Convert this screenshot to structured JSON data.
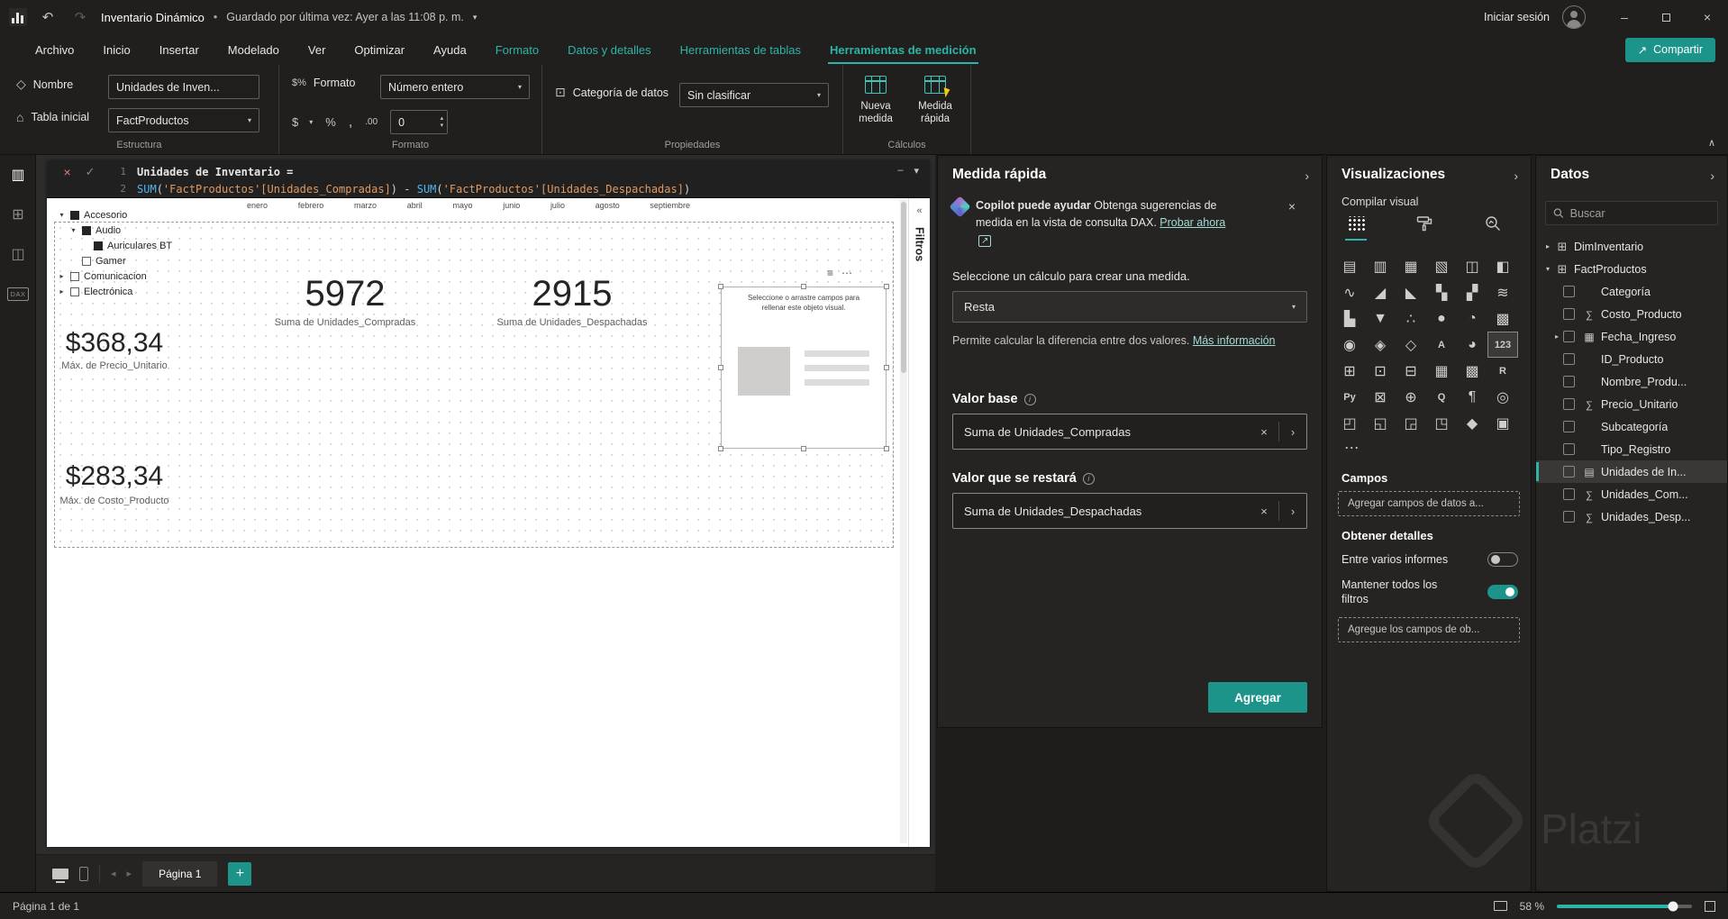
{
  "icons": {
    "bullet": "•",
    "caret_down": "▾",
    "caret_up": "∧",
    "chevron_right": "›",
    "expand_left": "«",
    "close": "×",
    "check": "✓",
    "undo": "↶",
    "redo": "↷",
    "more": "⋯",
    "lines": "≡",
    "arrow_ne": "↗",
    "minus": "–",
    "plus": "+",
    "nav_left": "◂",
    "nav_right": "▸",
    "home": "⌂",
    "tag": "◇",
    "dollar": "$",
    "percent": "%",
    "comma": ",",
    "decimals": ".00",
    "spin_up": "▴",
    "spin_down": "▾",
    "info": "i",
    "dax": "DAX",
    "report_view": "▥",
    "table_view": "⊞",
    "model_view": "◫"
  },
  "titlebar": {
    "app_title": "Inventario Dinámico",
    "bullet": "•",
    "save_status": "Guardado por última vez: Ayer a las 11:08 p. m.",
    "sign_in": "Iniciar sesión"
  },
  "share_label": "Compartir",
  "ribbon_tabs": [
    {
      "id": "archivo",
      "label": "Archivo",
      "cls": ""
    },
    {
      "id": "inicio",
      "label": "Inicio",
      "cls": ""
    },
    {
      "id": "insertar",
      "label": "Insertar",
      "cls": ""
    },
    {
      "id": "modelado",
      "label": "Modelado",
      "cls": ""
    },
    {
      "id": "ver",
      "label": "Ver",
      "cls": ""
    },
    {
      "id": "optimizar",
      "label": "Optimizar",
      "cls": ""
    },
    {
      "id": "ayuda",
      "label": "Ayuda",
      "cls": ""
    },
    {
      "id": "formato",
      "label": "Formato",
      "cls": "ctx"
    },
    {
      "id": "datos-y-detalles",
      "label": "Datos y detalles",
      "cls": "ctx"
    },
    {
      "id": "herramientas-de-tablas",
      "label": "Herramientas de tablas",
      "cls": "ctx"
    },
    {
      "id": "herramientas-de-medicion",
      "label": "Herramientas de medición",
      "cls": "ctx active"
    }
  ],
  "ribbon": {
    "estructura": {
      "label": "Estructura",
      "nombre_label": "Nombre",
      "nombre_value": "Unidades de Inven...",
      "tabla_label": "Tabla inicial",
      "tabla_value": "FactProductos"
    },
    "formato": {
      "label": "Formato",
      "field_label": "Formato",
      "field_value": "Número entero",
      "decimals_value": "0"
    },
    "propiedades": {
      "label": "Propiedades",
      "categoria_label": "Categoría de datos",
      "categoria_value": "Sin clasificar"
    },
    "calculos": {
      "label": "Cálculos",
      "nueva_medida": "Nueva medida",
      "medida_rapida": "Medida rápida"
    }
  },
  "formula": {
    "line1_no": "1",
    "line2_no": "2",
    "line1": "Unidades de Inventario =",
    "tokens": [
      {
        "text": "SUM",
        "cls": "fn"
      },
      {
        "text": "(",
        "cls": "pl"
      },
      {
        "text": "'FactProductos'",
        "cls": "tb"
      },
      {
        "text": "[Unidades_Compradas]",
        "cls": "cl"
      },
      {
        "text": ")",
        "cls": "pl"
      },
      {
        "text": " - ",
        "cls": "pl"
      },
      {
        "text": "SUM",
        "cls": "fn"
      },
      {
        "text": "(",
        "cls": "pl"
      },
      {
        "text": "'FactProductos'",
        "cls": "tb"
      },
      {
        "text": "[Unidades_Despachadas]",
        "cls": "cl"
      },
      {
        "text": ")",
        "cls": "pl"
      }
    ]
  },
  "canvas": {
    "months": [
      {
        "m": "enero"
      },
      {
        "m": "febrero"
      },
      {
        "m": "marzo"
      },
      {
        "m": "abril"
      },
      {
        "m": "mayo"
      },
      {
        "m": "junio"
      },
      {
        "m": "julio"
      },
      {
        "m": "agosto"
      },
      {
        "m": "septiembre"
      }
    ],
    "slicer": [
      {
        "ind": 0,
        "caret": "▾",
        "box": "filled",
        "label": "Accesorio"
      },
      {
        "ind": 13,
        "caret": "▾",
        "box": "filled",
        "label": "Audio"
      },
      {
        "ind": 26,
        "caret": "",
        "box": "filled",
        "label": "Auriculares BT"
      },
      {
        "ind": 13,
        "caret": "",
        "box": "empty",
        "label": "Gamer"
      },
      {
        "ind": 0,
        "caret": "▸",
        "box": "empty",
        "label": "Comunicacion"
      },
      {
        "ind": 0,
        "caret": "▸",
        "box": "empty",
        "label": "Electrónica"
      }
    ],
    "cards": {
      "c1": {
        "value": "5972",
        "label": "Suma de Unidades_Compradas"
      },
      "c2": {
        "value": "2915",
        "label": "Suma de Unidades_Despachadas"
      },
      "c3": {
        "value": "$368,34",
        "label": "Máx. de Precio_Unitario"
      },
      "c4": {
        "value": "$283,34",
        "label": "Máx. de Costo_Producto"
      }
    },
    "placeholder_text": "Seleccione o arrastre campos para rellenar este objeto visual.",
    "filters_label": "Filtros",
    "page_tab": "Página 1"
  },
  "quick_measure": {
    "title": "Medida rápida",
    "copilot_bold": "Copilot puede ayudar",
    "copilot_text": "Obtenga sugerencias de medida en la vista de consulta DAX.",
    "copilot_link": "Probar ahora",
    "instruction": "Seleccione un cálculo para crear una medida.",
    "calculation_value": "Resta",
    "description": "Permite calcular la diferencia entre dos valores.",
    "learn_more": "Más información",
    "base_label": "Valor base",
    "base_value": "Suma de Unidades_Compradas",
    "subtract_label": "Valor que se restará",
    "subtract_value": "Suma de Unidades_Despachadas",
    "add_label": "Agregar"
  },
  "visualizations": {
    "title": "Visualizaciones",
    "build_label": "Compilar visual",
    "more": "...",
    "fields_label": "Campos",
    "fields_placeholder": "Agregar campos de datos a...",
    "drill_label": "Obtener detalles",
    "sync_label": "Entre varios informes",
    "keep_filters_label": "Mantener todos los filtros",
    "drill_placeholder": "Agregue los campos de ob...",
    "icons": [
      {
        "g": "▤",
        "cls": "",
        "name": "stacked-bar-chart"
      },
      {
        "g": "▥",
        "cls": "",
        "name": "stacked-column-chart"
      },
      {
        "g": "▦",
        "cls": "",
        "name": "clustered-bar-chart"
      },
      {
        "g": "▧",
        "cls": "",
        "name": "clustered-column-chart"
      },
      {
        "g": "◫",
        "cls": "",
        "name": "100-stacked-bar-chart"
      },
      {
        "g": "◧",
        "cls": "",
        "name": "100-stacked-column-chart"
      },
      {
        "g": "∿",
        "cls": "",
        "name": "line-chart"
      },
      {
        "g": "◢",
        "cls": "",
        "name": "area-chart"
      },
      {
        "g": "◣",
        "cls": "",
        "name": "stacked-area-chart"
      },
      {
        "g": "▚",
        "cls": "",
        "name": "line-stacked-column-chart"
      },
      {
        "g": "▞",
        "cls": "",
        "name": "line-clustered-column-chart"
      },
      {
        "g": "≋",
        "cls": "",
        "name": "ribbon-chart"
      },
      {
        "g": "▙",
        "cls": "",
        "name": "waterfall-chart"
      },
      {
        "g": "▼",
        "cls": "",
        "name": "funnel-chart"
      },
      {
        "g": "∴",
        "cls": "",
        "name": "scatter-chart"
      },
      {
        "g": "●",
        "cls": "",
        "name": "pie-chart"
      },
      {
        "g": "◔",
        "cls": "",
        "name": "donut-chart"
      },
      {
        "g": "▩",
        "cls": "",
        "name": "treemap"
      },
      {
        "g": "◉",
        "cls": "",
        "name": "map"
      },
      {
        "g": "◈",
        "cls": "",
        "name": "filled-map"
      },
      {
        "g": "◇",
        "cls": "",
        "name": "shape-map"
      },
      {
        "g": "A",
        "cls": "txt",
        "name": "azure-map"
      },
      {
        "g": "◕",
        "cls": "",
        "name": "gauge"
      },
      {
        "g": "123",
        "cls": "sel txt",
        "name": "card"
      },
      {
        "g": "⊞",
        "cls": "",
        "name": "multi-row-card"
      },
      {
        "g": "⊡",
        "cls": "",
        "name": "kpi"
      },
      {
        "g": "⊟",
        "cls": "",
        "name": "slicer"
      },
      {
        "g": "▦",
        "cls": "",
        "name": "table"
      },
      {
        "g": "▩",
        "cls": "",
        "name": "matrix"
      },
      {
        "g": "R",
        "cls": "txt",
        "name": "r-script"
      },
      {
        "g": "Py",
        "cls": "txt",
        "name": "python"
      },
      {
        "g": "⊠",
        "cls": "",
        "name": "key-influencers"
      },
      {
        "g": "⊕",
        "cls": "",
        "name": "decomposition-tree"
      },
      {
        "g": "Q",
        "cls": "txt",
        "name": "qa"
      },
      {
        "g": "¶",
        "cls": "",
        "name": "smart-narrative"
      },
      {
        "g": "◎",
        "cls": "",
        "name": "metrics"
      },
      {
        "g": "◰",
        "cls": "",
        "name": "paginated-report"
      },
      {
        "g": "◱",
        "cls": "",
        "name": "power-apps"
      },
      {
        "g": "◲",
        "cls": "",
        "name": "power-automate"
      },
      {
        "g": "◳",
        "cls": "",
        "name": "arcgis"
      },
      {
        "g": "◆",
        "cls": "",
        "name": "custom-visual-1"
      },
      {
        "g": "▣",
        "cls": "",
        "name": "custom-visual-2"
      }
    ]
  },
  "data_pane": {
    "title": "Datos",
    "search_placeholder": "Buscar",
    "items": [
      {
        "pad": 6,
        "chev": "▸",
        "cb": "hide",
        "icon": "table",
        "label": "DimInventario",
        "cls": "",
        "name": "diminventario"
      },
      {
        "pad": 6,
        "chev": "▾",
        "cb": "hide",
        "icon": "table",
        "label": "FactProductos",
        "cls": "",
        "name": "factproductos"
      },
      {
        "pad": 16,
        "chev": "",
        "cb": "show",
        "icon": "none",
        "label": "Categoría",
        "cls": "",
        "name": "categoria"
      },
      {
        "pad": 16,
        "chev": "",
        "cb": "show",
        "icon": "sigma",
        "label": "Costo_Producto",
        "cls": "",
        "name": "costo-producto"
      },
      {
        "pad": 16,
        "chev": "▸",
        "cb": "show",
        "icon": "cal",
        "label": "Fecha_Ingreso",
        "cls": "",
        "name": "fecha-ingreso"
      },
      {
        "pad": 16,
        "chev": "",
        "cb": "show",
        "icon": "none",
        "label": "ID_Producto",
        "cls": "",
        "name": "id-producto"
      },
      {
        "pad": 16,
        "chev": "",
        "cb": "show",
        "icon": "none",
        "label": "Nombre_Produ...",
        "cls": "",
        "name": "nombre-producto"
      },
      {
        "pad": 16,
        "chev": "",
        "cb": "show",
        "icon": "sigma",
        "label": "Precio_Unitario",
        "cls": "",
        "name": "precio-unitario"
      },
      {
        "pad": 16,
        "chev": "",
        "cb": "show",
        "icon": "none",
        "label": "Subcategoría",
        "cls": "",
        "name": "subcategoria"
      },
      {
        "pad": 16,
        "chev": "",
        "cb": "show",
        "icon": "none",
        "label": "Tipo_Registro",
        "cls": "",
        "name": "tipo-registro"
      },
      {
        "pad": 16,
        "chev": "",
        "cb": "show",
        "icon": "grid",
        "label": "Unidades de In...",
        "cls": "hl",
        "name": "unidades-de-inventario"
      },
      {
        "pad": 16,
        "chev": "",
        "cb": "show",
        "icon": "sigma",
        "label": "Unidades_Com...",
        "cls": "",
        "name": "unidades-compradas"
      },
      {
        "pad": 16,
        "chev": "",
        "cb": "show",
        "icon": "sigma",
        "label": "Unidades_Desp...",
        "cls": "",
        "name": "unidades-despachadas"
      }
    ]
  },
  "status": {
    "left": "Página 1 de 1",
    "zoom": "58 %"
  },
  "watermark": "Platzi"
}
